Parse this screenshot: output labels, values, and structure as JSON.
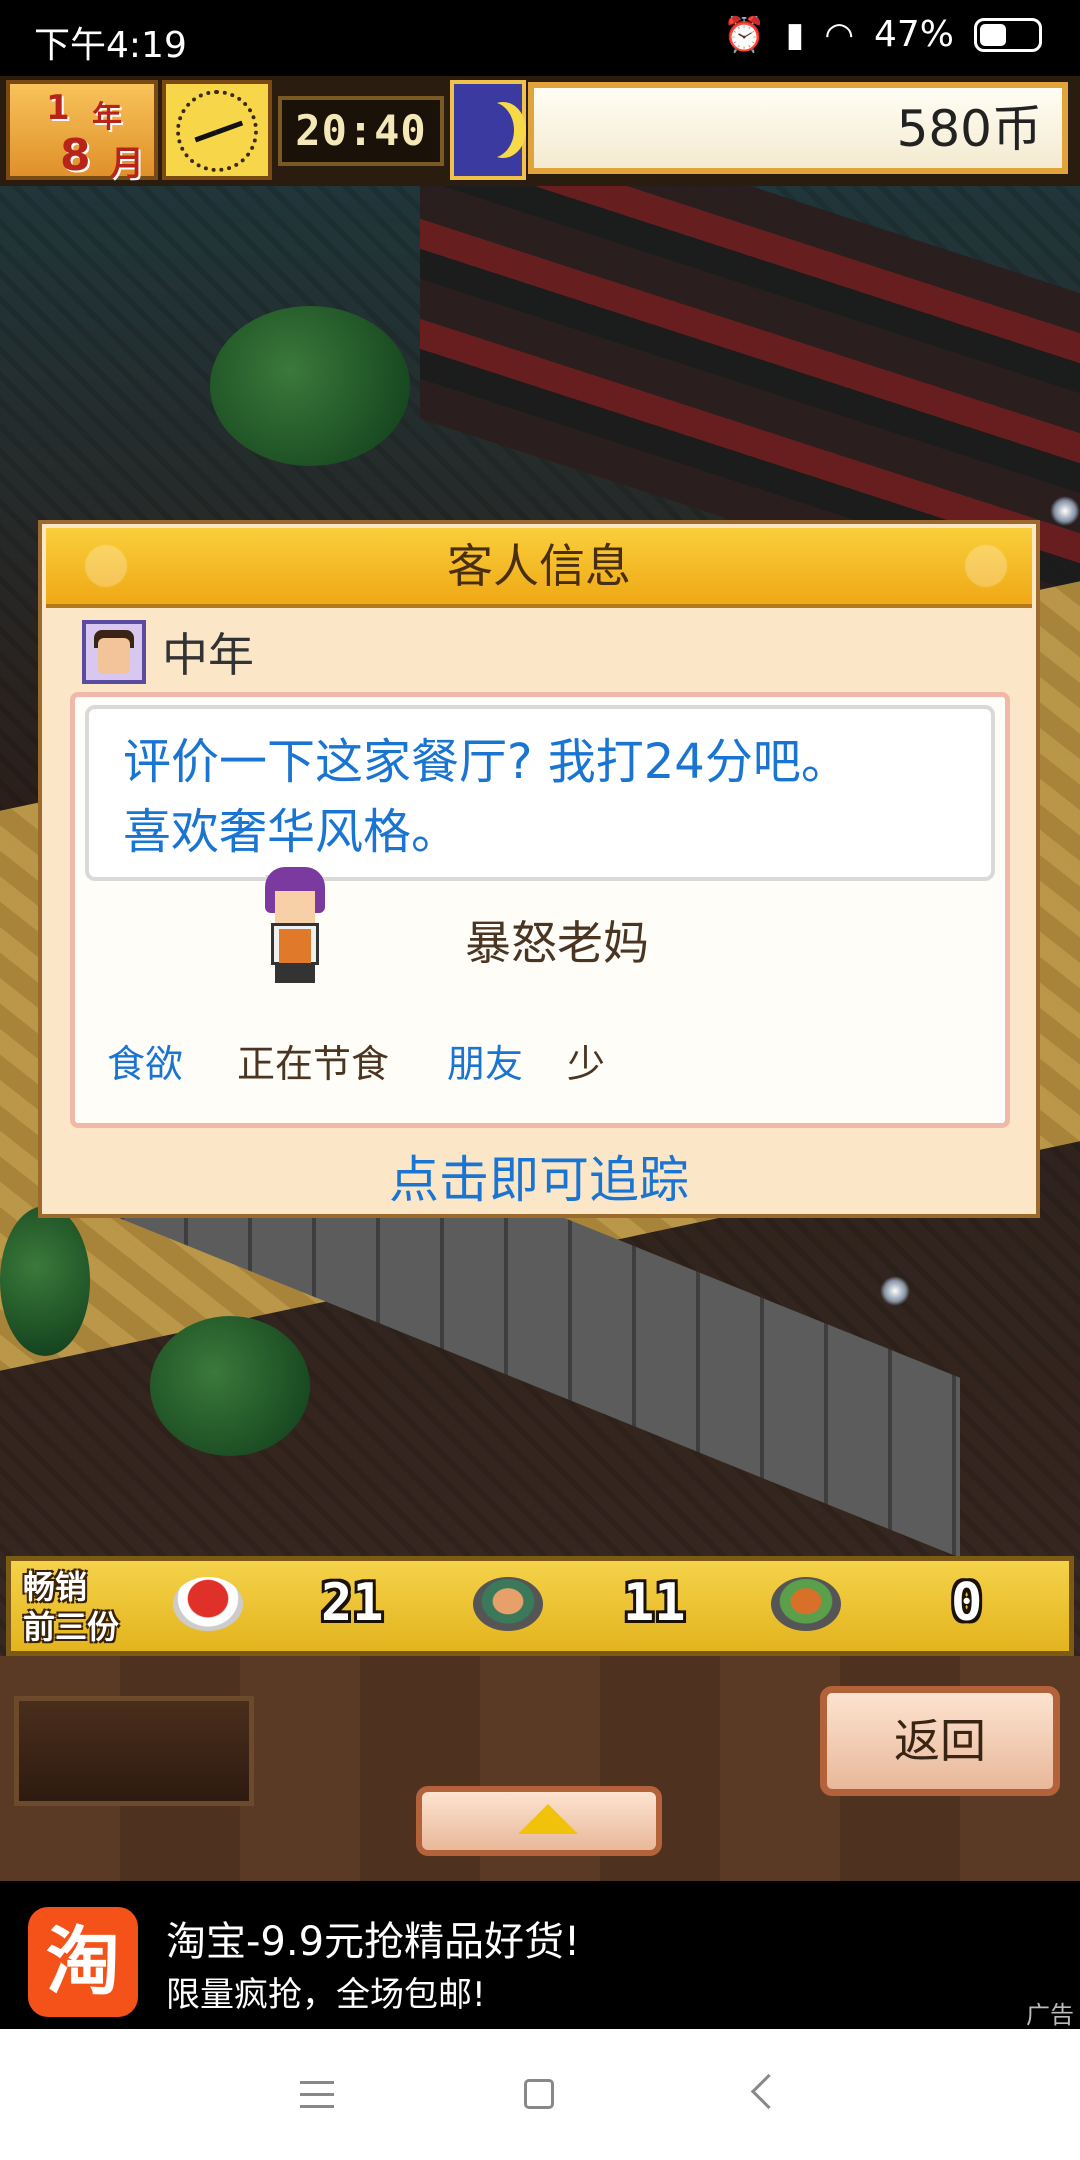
{
  "status_bar": {
    "time": "下午4:19",
    "battery": "47%"
  },
  "game_header": {
    "year_num": "1",
    "year_label": "年",
    "month_num": "8",
    "month_label": "月",
    "clock_time": "20:40",
    "coins": "580币"
  },
  "dialog": {
    "title": "客人信息",
    "customer_type": "中年",
    "speech_line1": "评价一下这家餐厅? 我打24分吧。",
    "speech_line2": "喜欢奢华风格。",
    "nickname": "暴怒老妈",
    "stat1_label": "食欲",
    "stat1_value": "正在节食",
    "stat2_label": "朋友",
    "stat2_value": "少",
    "trace_hint": "点击即可追踪"
  },
  "bestsellers": {
    "label_line1": "畅销",
    "label_line2": "前三份",
    "items": [
      {
        "count": "21"
      },
      {
        "count": "11"
      },
      {
        "count": "0"
      }
    ]
  },
  "bottom_panel": {
    "back_label": "返回"
  },
  "ad": {
    "logo_text": "淘",
    "title": "淘宝-9.9元抢精品好货!",
    "subtitle": "限量疯抢，全场包邮!",
    "tag": "广告"
  },
  "colors": {
    "link_blue": "#1a74d2",
    "dialog_bg": "#fbe7c8",
    "header_gold": "#f0a816"
  }
}
